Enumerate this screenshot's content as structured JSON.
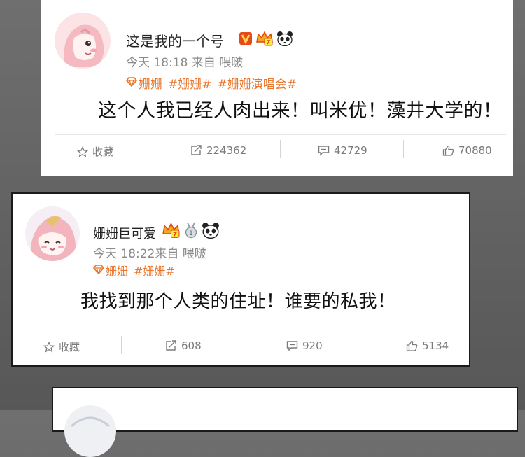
{
  "post1": {
    "username": "这是我的一个号",
    "meta": "今天 18:18 来自 喂啵",
    "tags": [
      "姗姗",
      "#姗姗#",
      "#姗姗演唱会#"
    ],
    "text": "这个人我已经人肉出来！叫米优！藻井大学的！",
    "actions": {
      "favorite": "收藏",
      "repost": "224362",
      "comment": "42729",
      "like": "70880"
    }
  },
  "post2": {
    "username": "姗姗巨可爱",
    "meta": "今天 18:22来自 喂啵",
    "tags": [
      "姗姗",
      "#姗姗#"
    ],
    "text": "我找到那个人类的住址！谁要的私我！",
    "actions": {
      "favorite": "收藏",
      "repost": "608",
      "comment": "920",
      "like": "5134"
    }
  },
  "colors": {
    "tag": "#e8772e",
    "meta": "#8a8a8a",
    "vip": "#e64a19"
  }
}
